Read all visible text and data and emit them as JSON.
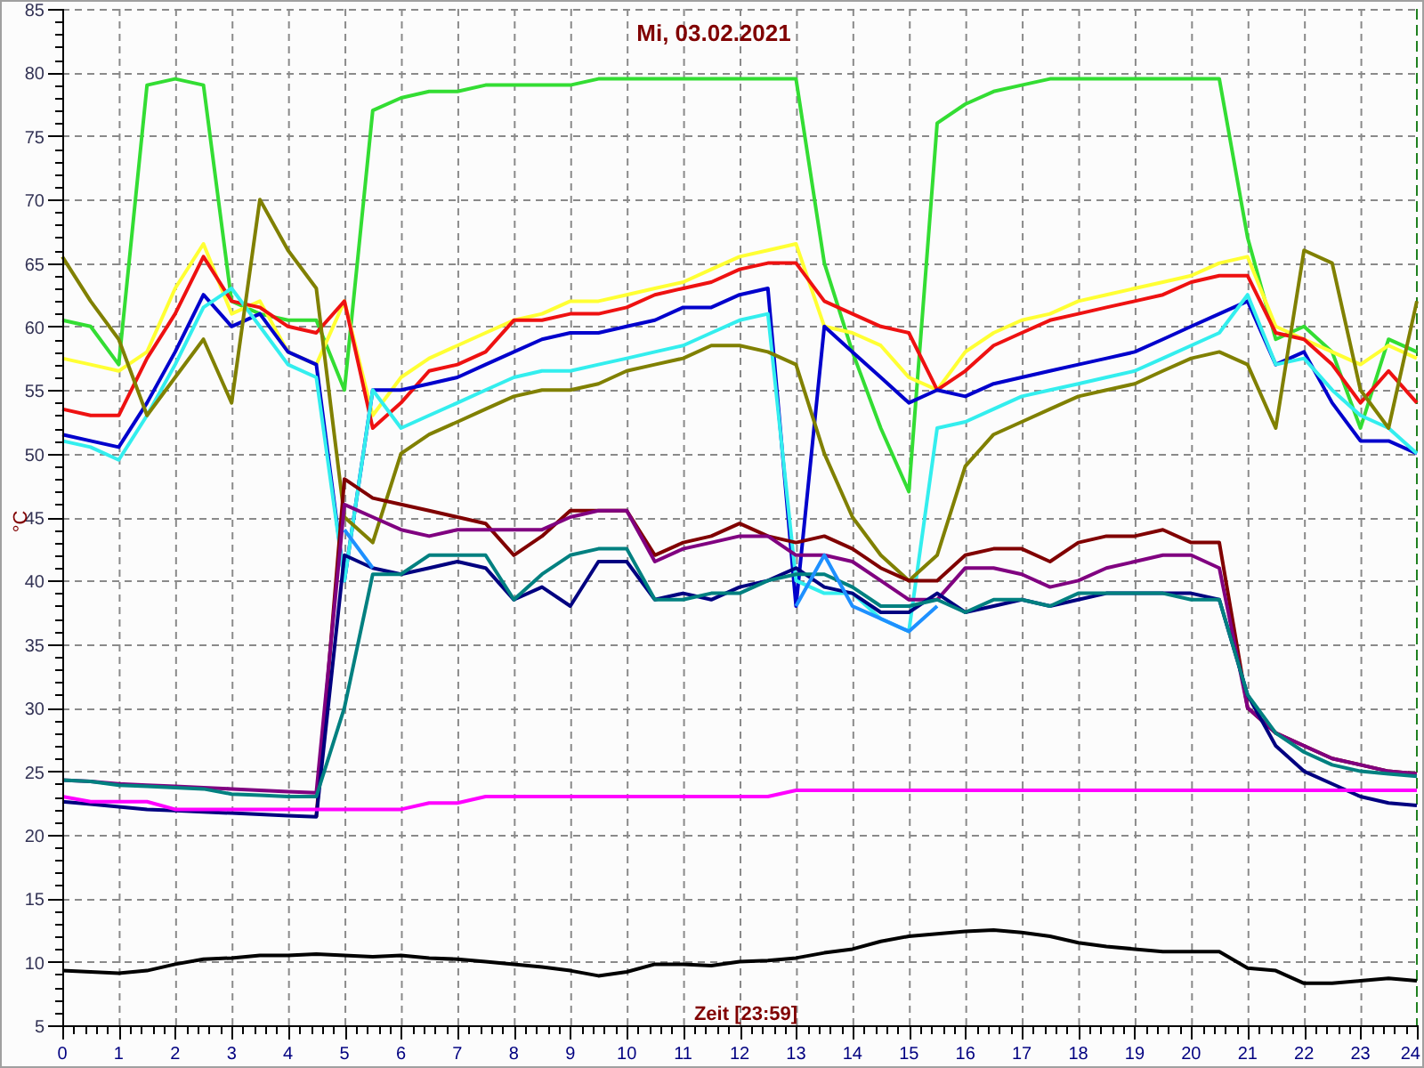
{
  "chart_data": {
    "type": "line",
    "grid": true,
    "title": "Mi, 03.02.2021",
    "xlabel": "Zeit [23:59]",
    "ylabel": "°C",
    "xlim": [
      0,
      24
    ],
    "ylim": [
      5,
      85
    ],
    "xticks": [
      0,
      1,
      2,
      3,
      4,
      5,
      6,
      7,
      8,
      9,
      10,
      11,
      12,
      13,
      14,
      15,
      16,
      17,
      18,
      19,
      20,
      21,
      22,
      23,
      24
    ],
    "yticks": [
      5,
      10,
      15,
      20,
      25,
      30,
      35,
      40,
      45,
      50,
      55,
      60,
      65,
      70,
      75,
      80,
      85
    ],
    "x": [
      0,
      0.5,
      1,
      1.5,
      2,
      2.5,
      3,
      3.5,
      4,
      4.5,
      5,
      5.5,
      6,
      6.5,
      7,
      7.5,
      8,
      8.5,
      9,
      9.5,
      10,
      10.5,
      11,
      11.5,
      12,
      12.5,
      13,
      13.5,
      14,
      14.5,
      15,
      15.5,
      16,
      16.5,
      17,
      17.5,
      18,
      18.5,
      19,
      19.5,
      20,
      20.5,
      21,
      21.5,
      22,
      22.5,
      23,
      23.5,
      24
    ],
    "series": [
      {
        "color": "#33dd33",
        "values": [
          60.5,
          60,
          57,
          79,
          79.5,
          79,
          62,
          61,
          60.5,
          60.5,
          55,
          77,
          78,
          78.5,
          78.5,
          79,
          79,
          79,
          79,
          79.5,
          79.5,
          79.5,
          79.5,
          79.5,
          79.5,
          79.5,
          79.5,
          65,
          58,
          52,
          47,
          76,
          77.5,
          78.5,
          79,
          79.5,
          79.5,
          79.5,
          79.5,
          79.5,
          79.5,
          79.5,
          67,
          59,
          60,
          58,
          52,
          59,
          58
        ]
      },
      {
        "color": "#ffff33",
        "values": [
          57.5,
          57,
          56.5,
          58,
          63,
          66.5,
          61,
          62,
          58,
          57,
          62,
          53,
          56,
          57.5,
          58.5,
          59.5,
          60.5,
          61,
          62,
          62,
          62.5,
          63,
          63.5,
          64.5,
          65.5,
          66,
          66.5,
          60,
          59.5,
          58.5,
          56,
          55,
          58,
          59.5,
          60.5,
          61,
          62,
          62.5,
          63,
          63.5,
          64,
          65,
          65.5,
          60,
          59,
          58,
          57,
          58.5,
          57.5
        ]
      },
      {
        "color": "#ee1111",
        "values": [
          53.5,
          53,
          53,
          57.5,
          61,
          65.5,
          62,
          61.5,
          60,
          59.5,
          62,
          52,
          54,
          56.5,
          57,
          58,
          60.5,
          60.5,
          61,
          61,
          61.5,
          62.5,
          63,
          63.5,
          64.5,
          65,
          65,
          62,
          61,
          60,
          59.5,
          55,
          56.5,
          58.5,
          59.5,
          60.5,
          61,
          61.5,
          62,
          62.5,
          63.5,
          64,
          64,
          59.5,
          59,
          57,
          54,
          56.5,
          54
        ]
      },
      {
        "color": "#0000cc",
        "values": [
          51.5,
          51,
          50.5,
          54,
          58,
          62.5,
          60,
          61,
          58,
          57,
          40,
          55,
          55,
          55.5,
          56,
          57,
          58,
          59,
          59.5,
          59.5,
          60,
          60.5,
          61.5,
          61.5,
          62.5,
          63,
          38,
          60,
          58,
          56,
          54,
          55,
          54.5,
          55.5,
          56,
          56.5,
          57,
          57.5,
          58,
          59,
          60,
          61,
          62,
          57,
          58,
          54,
          51,
          51,
          50
        ]
      },
      {
        "color": "#33eeee",
        "values": [
          51,
          50.5,
          49.5,
          53,
          57,
          61.5,
          63,
          60,
          57,
          56,
          40,
          55,
          52,
          53,
          54,
          55,
          56,
          56.5,
          56.5,
          57,
          57.5,
          58,
          58.5,
          59.5,
          60.5,
          61,
          40,
          39,
          39,
          37,
          36,
          52,
          52.5,
          53.5,
          54.5,
          55,
          55.5,
          56,
          56.5,
          57.5,
          58.5,
          59.5,
          62.5,
          57,
          57.5,
          55,
          53,
          52,
          50
        ]
      },
      {
        "color": "#808000",
        "values": [
          65.5,
          62,
          59,
          53,
          56,
          59,
          54,
          70,
          66,
          63,
          45,
          43,
          50,
          51.5,
          52.5,
          53.5,
          54.5,
          55,
          55,
          55.5,
          56.5,
          57,
          57.5,
          58.5,
          58.5,
          58,
          57,
          50,
          45,
          42,
          40,
          42,
          49,
          51.5,
          52.5,
          53.5,
          54.5,
          55,
          55.5,
          56.5,
          57.5,
          58,
          57,
          52,
          66,
          65,
          55,
          52,
          62
        ]
      },
      {
        "color": "#800000",
        "values": [
          null,
          null,
          null,
          null,
          null,
          null,
          null,
          null,
          null,
          21.4,
          48,
          46.5,
          46,
          45.5,
          45,
          44.5,
          42,
          43.5,
          45.5,
          45.5,
          45.5,
          42,
          43,
          43.5,
          44.5,
          43.5,
          43,
          43.5,
          42.5,
          41,
          40,
          40,
          42,
          42.5,
          42.5,
          41.5,
          43,
          43.5,
          43.5,
          44,
          43,
          43,
          30,
          28,
          27,
          26,
          25.5,
          25,
          24.8
        ]
      },
      {
        "color": "#800080",
        "values": [
          24.3,
          24.2,
          24,
          23.9,
          23.8,
          23.7,
          23.6,
          23.5,
          23.4,
          23.3,
          46,
          45,
          44,
          43.5,
          44,
          44,
          44,
          44,
          45,
          45.5,
          45.5,
          41.5,
          42.5,
          43,
          43.5,
          43.5,
          42,
          42,
          41.5,
          40,
          38.5,
          38.5,
          41,
          41,
          40.5,
          39.5,
          40,
          41,
          41.5,
          42,
          42,
          41,
          30,
          28,
          27,
          26,
          25.5,
          25,
          24.8
        ]
      },
      {
        "color": "#000080",
        "values": [
          22.6,
          22.4,
          22.2,
          22,
          21.9,
          21.8,
          21.7,
          21.6,
          21.5,
          21.4,
          42,
          41,
          40.5,
          41,
          41.5,
          41,
          38.5,
          39.5,
          38,
          41.5,
          41.5,
          38.5,
          39,
          38.5,
          39.5,
          40,
          41,
          39.5,
          39,
          37.5,
          37.5,
          39,
          37.5,
          38,
          38.5,
          38,
          38.5,
          39,
          39,
          39,
          39,
          38.5,
          31,
          27,
          25,
          24,
          23,
          22.5,
          22.3
        ]
      },
      {
        "color": "#008080",
        "values": [
          24.3,
          24.2,
          23.9,
          23.8,
          23.7,
          23.6,
          23.2,
          23.1,
          23,
          23,
          30,
          40.5,
          40.5,
          42,
          42,
          42,
          38.5,
          40.5,
          42,
          42.5,
          42.5,
          38.5,
          38.5,
          39,
          39,
          40,
          40.5,
          40.5,
          39.5,
          38,
          38,
          38.5,
          37.5,
          38.5,
          38.5,
          38,
          39,
          39,
          39,
          39,
          38.5,
          38.5,
          31,
          28,
          26.5,
          25.5,
          25,
          24.8,
          24.6
        ]
      },
      {
        "color": "#1e90ff",
        "values": [
          null,
          null,
          null,
          null,
          null,
          null,
          null,
          null,
          null,
          null,
          44,
          41,
          null,
          null,
          null,
          null,
          null,
          null,
          null,
          null,
          null,
          null,
          null,
          null,
          null,
          null,
          38,
          42,
          38,
          37,
          36,
          38,
          null,
          null,
          null,
          null,
          null,
          null,
          null,
          null,
          null,
          null,
          null,
          null,
          null,
          null,
          null,
          null,
          null
        ]
      },
      {
        "color": "#ff00ff",
        "values": [
          23,
          22.6,
          22.6,
          22.6,
          22,
          22,
          22,
          22,
          22,
          22,
          22,
          22,
          22,
          22.5,
          22.5,
          23,
          23,
          23,
          23,
          23,
          23,
          23,
          23,
          23,
          23,
          23,
          23.5,
          23.5,
          23.5,
          23.5,
          23.5,
          23.5,
          23.5,
          23.5,
          23.5,
          23.5,
          23.5,
          23.5,
          23.5,
          23.5,
          23.5,
          23.5,
          23.5,
          23.5,
          23.5,
          23.5,
          23.5,
          23.5,
          23.5
        ]
      },
      {
        "color": "#000000",
        "values": [
          9.3,
          9.2,
          9.1,
          9.3,
          9.8,
          10.2,
          10.3,
          10.5,
          10.5,
          10.6,
          10.5,
          10.4,
          10.5,
          10.3,
          10.2,
          10,
          9.8,
          9.6,
          9.3,
          8.9,
          9.2,
          9.8,
          9.8,
          9.7,
          10,
          10.1,
          10.3,
          10.7,
          11,
          11.6,
          12,
          12.2,
          12.4,
          12.5,
          12.3,
          12,
          11.5,
          11.2,
          11,
          10.8,
          10.8,
          10.8,
          9.5,
          9.3,
          8.3,
          8.3,
          8.5,
          8.7,
          8.5
        ]
      }
    ]
  }
}
